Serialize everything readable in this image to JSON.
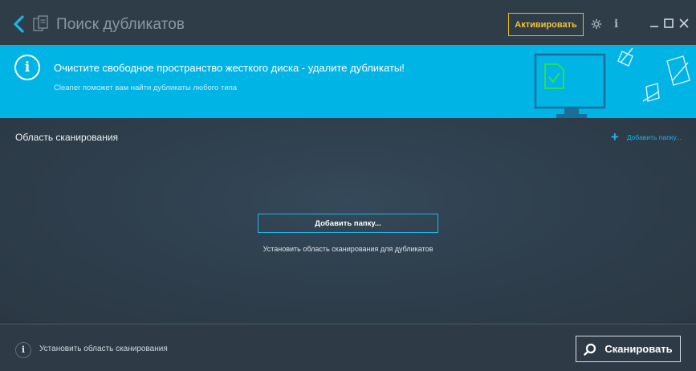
{
  "window": {
    "title": "Поиск дубликатов",
    "activate_label": "Активировать",
    "icons": [
      "back-arrow-icon",
      "duplicate-files-icon",
      "gear-icon",
      "info-icon",
      "minimize-icon",
      "maximize-icon",
      "close-icon"
    ],
    "info_glyph": "i"
  },
  "banner": {
    "title": "Очистите свободное пространство жесткого диска - удалите дубликаты!",
    "subtitle": "Cleaner поможет вам найти дубликаты любого типа",
    "info_glyph": "i",
    "background_color": "#00b4e6"
  },
  "scan_area": {
    "title": "Область сканирования",
    "add_folder_link": "Добавить папку...",
    "add_folder_button": "Добавить папку...",
    "hint": "Установить область сканирования для дубликатов"
  },
  "footer": {
    "info_glyph": "i",
    "status_text": "Установить область сканирования",
    "scan_button": "Сканировать"
  },
  "colors": {
    "accent": "#19b5ea",
    "activate": "#f4c430",
    "background": "#2e3b47"
  }
}
